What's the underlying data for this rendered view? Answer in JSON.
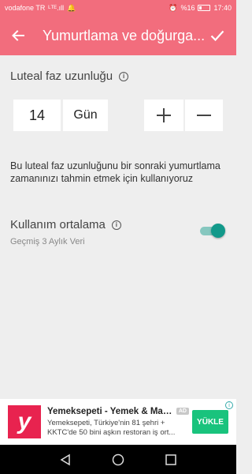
{
  "status_bar": {
    "carrier": "vodafone TR",
    "signal": "ᴸᵀᴱ.ıll",
    "battery_text": "%16",
    "time": "17:40"
  },
  "app_bar": {
    "title": "Yumurtlama ve doğurga...",
    "back_icon": "arrow-left-icon",
    "confirm_icon": "check-icon"
  },
  "luteal": {
    "label": "Luteal faz uzunluğu",
    "value": "14",
    "unit": "Gün",
    "increment_icon": "plus-icon",
    "decrement_icon": "minus-icon",
    "description": "Bu luteal faz uzunluğunu bir sonraki yumurtlama zamanınızı tahmin etmek için kullanıyoruz"
  },
  "average": {
    "label": "Kullanım ortalama",
    "sublabel": "Geçmiş 3 Aylık Veri",
    "enabled": true
  },
  "ad": {
    "logo_text": "y",
    "title": "Yemeksepeti - Yemek & Mar...",
    "badge": "AD",
    "description": "Yemeksepeti, Türkiye'nin 81 şehri + KKTC'de 50 bini aşkın restoran iş ort...",
    "button_label": "YÜKLE",
    "accent_color": "#19c37d",
    "logo_color": "#e8234f"
  },
  "colors": {
    "primary": "#f26d7d",
    "toggle_on": "#12998a"
  }
}
